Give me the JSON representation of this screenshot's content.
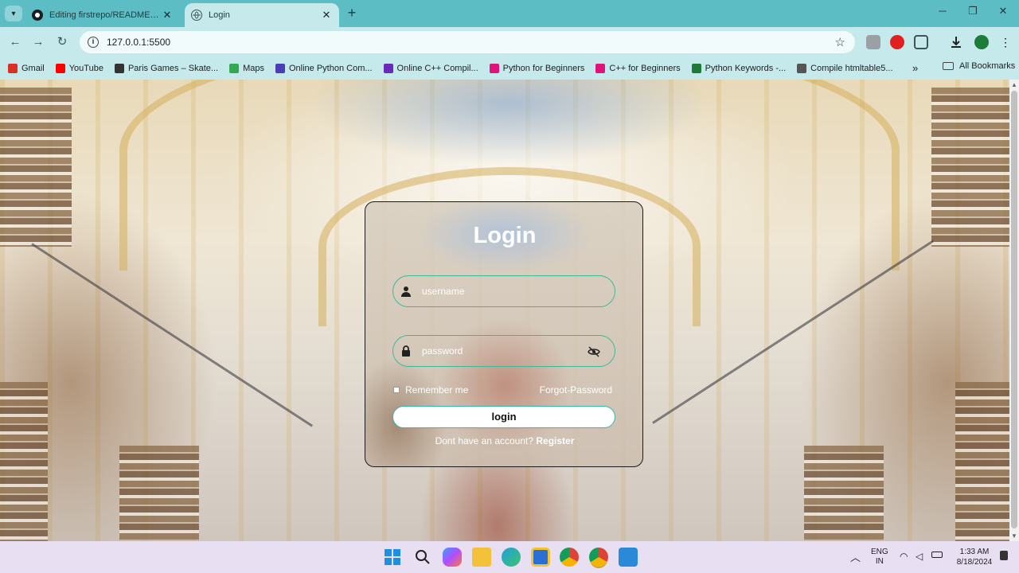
{
  "browser": {
    "tabs": [
      {
        "title": "Editing firstrepo/README.md a",
        "active": false
      },
      {
        "title": "Login",
        "active": true
      }
    ],
    "url": "127.0.0.1:5500",
    "bookmarks": [
      {
        "label": "Gmail",
        "color": "#d93025"
      },
      {
        "label": "YouTube",
        "color": "#ff0000"
      },
      {
        "label": "Paris Games – Skate...",
        "color": "#333333"
      },
      {
        "label": "Maps",
        "color": "#34a853"
      },
      {
        "label": "Online Python Com...",
        "color": "#4b3fb5"
      },
      {
        "label": "Online C++ Compil...",
        "color": "#6a2ab8"
      },
      {
        "label": "Python for Beginners",
        "color": "#e0137b"
      },
      {
        "label": "C++ for Beginners",
        "color": "#e0137b"
      },
      {
        "label": "Python Keywords -...",
        "color": "#1f7a3a"
      },
      {
        "label": "Compile htmltable5...",
        "color": "#555555"
      }
    ],
    "more_label": "»",
    "all_bookmarks_label": "All Bookmarks"
  },
  "login": {
    "title": "Login",
    "username_placeholder": "username",
    "password_placeholder": "password",
    "remember_label": "Remember me",
    "forgot_label": "Forgot-Password",
    "button_label": "login",
    "register_prompt": "Dont have an account?",
    "register_link": "Register"
  },
  "taskbar": {
    "language": "ENG",
    "region": "IN",
    "time": "1:33 AM",
    "date": "8/18/2024"
  },
  "colors": {
    "tab_strip": "#5dbdc4",
    "toolbar": "#c6eaec",
    "field_border": "#3fb89a",
    "taskbar": "#e9dff2"
  }
}
